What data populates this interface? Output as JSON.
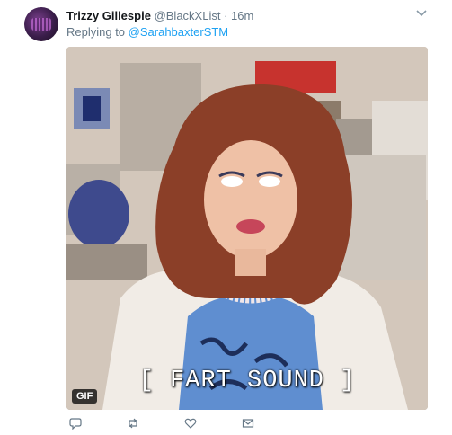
{
  "tweet": {
    "name": "Trizzy Gillespie",
    "handle": "@BlackXList",
    "separator": "·",
    "time": "16m",
    "reply_prefix": "Replying to",
    "reply_to": "@SarahbaxterSTM",
    "media": {
      "caption": "[ FART SOUND ]",
      "badge": "GIF"
    }
  },
  "icons": {
    "caret": "chevron-down-icon",
    "reply": "reply-icon",
    "retweet": "retweet-icon",
    "like": "heart-icon",
    "dm": "mail-icon"
  },
  "colors": {
    "link": "#1da1f2",
    "muted": "#657786",
    "text": "#14171a"
  }
}
